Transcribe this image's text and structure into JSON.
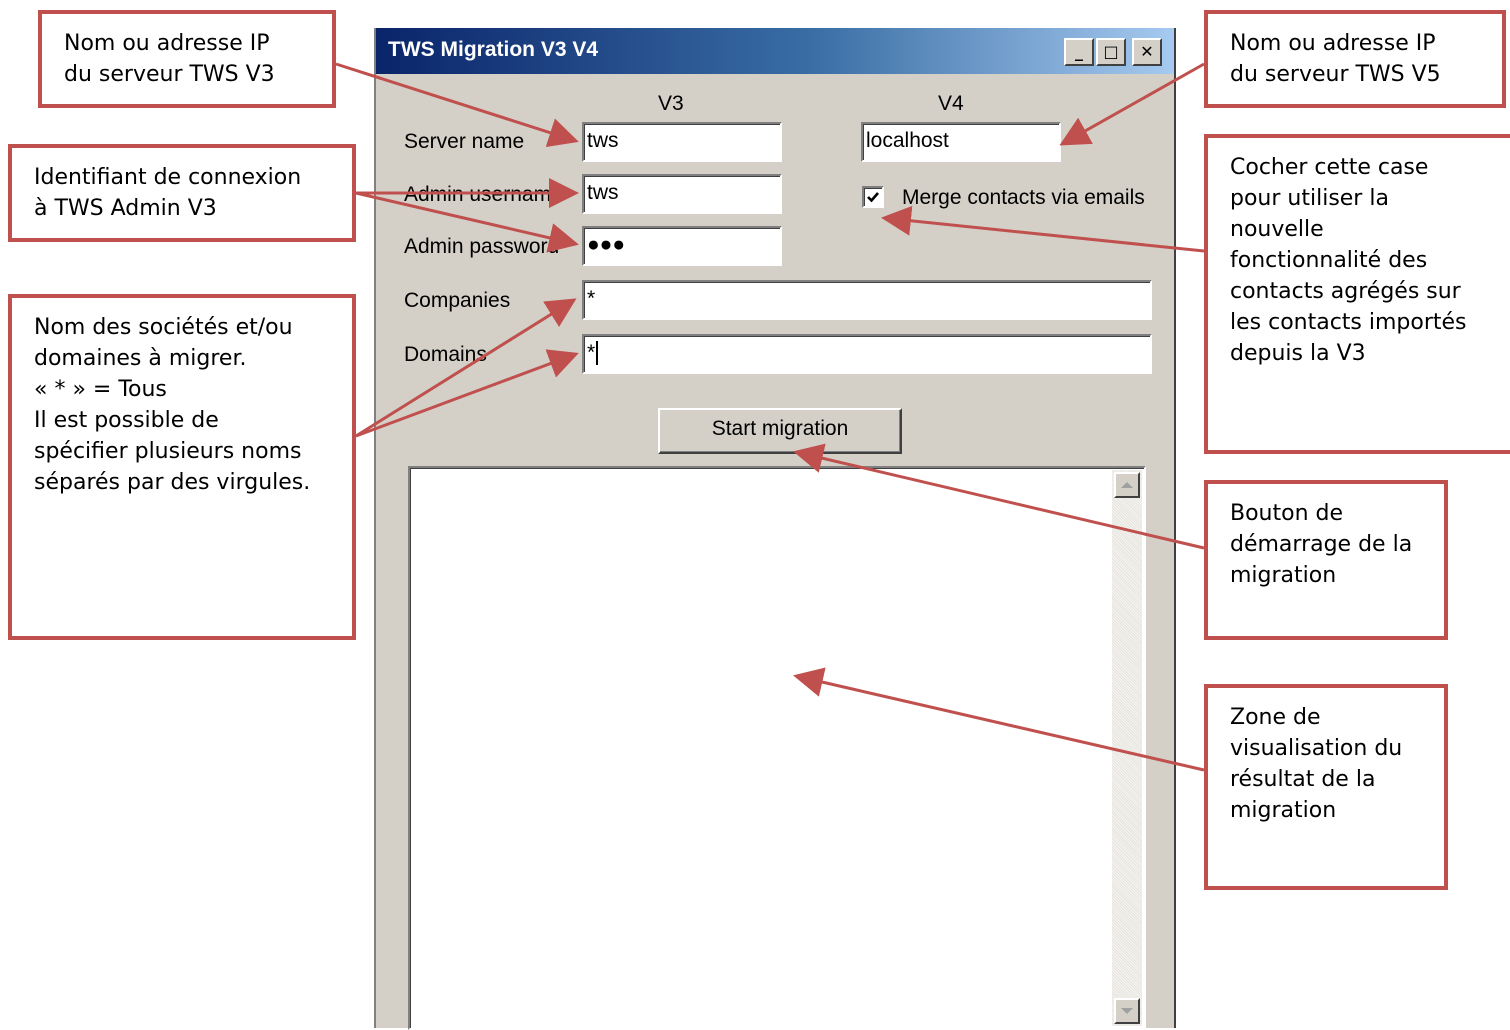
{
  "window": {
    "title": "TWS Migration V3 V4",
    "controls": {
      "minimize": "_",
      "maximize": "□",
      "close": "✕"
    },
    "col_v3": "V3",
    "col_v4": "V4",
    "labels": {
      "server_name": "Server name",
      "admin_username": "Admin username",
      "admin_password": "Admin password",
      "companies": "Companies",
      "domains": "Domains"
    },
    "inputs": {
      "server_v3": "tws",
      "username_v3": "tws",
      "password_v3": "●●●",
      "server_v4": "localhost",
      "companies": "*",
      "domains": "*"
    },
    "merge_contacts": {
      "label": "Merge contacts via emails",
      "checked": true
    },
    "start_button": "Start migration",
    "output": ""
  },
  "callouts": {
    "server_v3": "Nom ou adresse IP\ndu serveur TWS V3",
    "server_v5": "Nom ou adresse IP\ndu serveur TWS V5",
    "admin_id": "Identifiant de connexion\nà TWS Admin V3",
    "companies_domains": "Nom des sociétés et/ou\ndomaines à migrer.\n« * » = Tous\nIl est possible de\nspécifier plusieurs noms\nséparés par des virgules.",
    "merge": "Cocher cette case\npour utiliser la\nnouvelle\nfonctionnalité des\ncontacts agrégés sur\nles contacts importés\ndepuis la V3",
    "start": "Bouton de\ndémarrage de la\nmigration",
    "results": "Zone de\nvisualisation du\nrésultat de la\nmigration"
  },
  "colors": {
    "callout_border": "#c0504d",
    "arrow": "#c0504d",
    "window_face": "#d4d0c8",
    "titlebar": "#0a246a"
  }
}
